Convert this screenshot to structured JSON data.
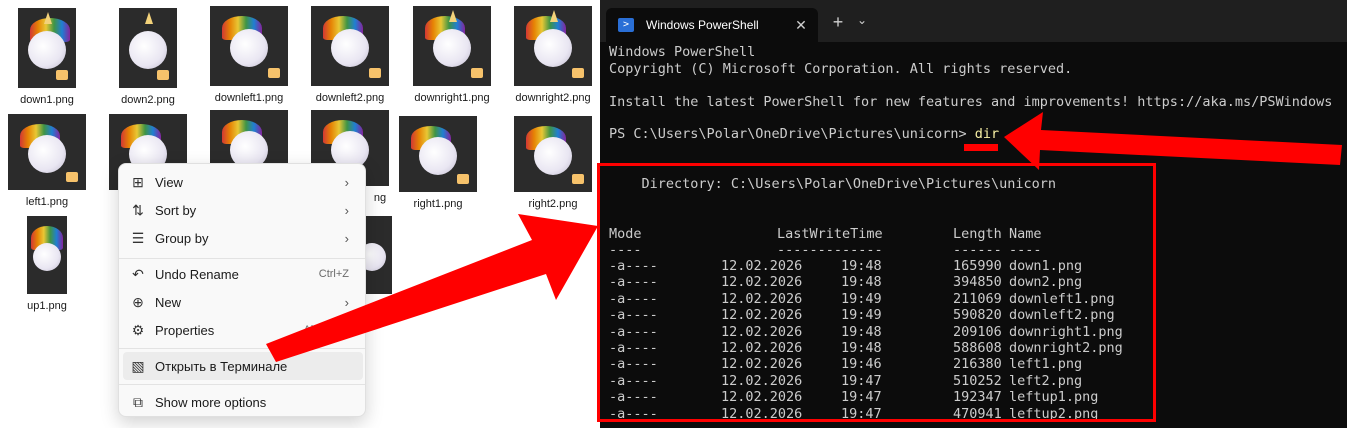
{
  "explorer": {
    "files": [
      {
        "name": "down1.png"
      },
      {
        "name": "down2.png"
      },
      {
        "name": "downleft1.png"
      },
      {
        "name": "downleft2.png"
      },
      {
        "name": "downright1.png"
      },
      {
        "name": "downright2.png"
      },
      {
        "name": "left1.png"
      },
      {
        "name": "right1.png"
      },
      {
        "name": "right2.png"
      },
      {
        "name": "up1.png"
      }
    ],
    "partial_labels": [
      "ng",
      "ng"
    ]
  },
  "context_menu": {
    "items": [
      {
        "label": "View",
        "icon": "grid-icon",
        "has_submenu": true
      },
      {
        "label": "Sort by",
        "icon": "sort-icon",
        "has_submenu": true
      },
      {
        "label": "Group by",
        "icon": "list-icon",
        "has_submenu": true
      },
      {
        "label": "Undo Rename",
        "icon": "undo-icon",
        "shortcut": "Ctrl+Z"
      },
      {
        "label": "New",
        "icon": "plus-circle-icon",
        "has_submenu": true
      },
      {
        "label": "Properties",
        "icon": "wrench-icon",
        "shortcut": "Alt+Enter"
      },
      {
        "label": "Открыть в Терминале",
        "icon": "terminal-icon",
        "highlighted": true
      },
      {
        "label": "Show more options",
        "icon": "share-icon"
      }
    ]
  },
  "terminal": {
    "tab_title": "Windows PowerShell",
    "banner_1": "Windows PowerShell",
    "banner_2": "Copyright (C) Microsoft Corporation. All rights reserved.",
    "banner_3": "Install the latest PowerShell for new features and improvements! https://aka.ms/PSWindows",
    "prompt": "PS C:\\Users\\Polar\\OneDrive\\Pictures\\unicorn> ",
    "command": "dir",
    "directory_line": "    Directory: C:\\Users\\Polar\\OneDrive\\Pictures\\unicorn",
    "headers": {
      "mode": "Mode",
      "lastwritetime": "LastWriteTime",
      "length": "Length",
      "name": "Name"
    },
    "underlines": {
      "mode": "----",
      "lastwritetime": "-------------",
      "length": "------",
      "name": "----"
    },
    "rows": [
      {
        "mode": "-a----",
        "date": "12.02.2026",
        "time": "19:48",
        "length": "165990",
        "name": "down1.png"
      },
      {
        "mode": "-a----",
        "date": "12.02.2026",
        "time": "19:48",
        "length": "394850",
        "name": "down2.png"
      },
      {
        "mode": "-a----",
        "date": "12.02.2026",
        "time": "19:49",
        "length": "211069",
        "name": "downleft1.png"
      },
      {
        "mode": "-a----",
        "date": "12.02.2026",
        "time": "19:49",
        "length": "590820",
        "name": "downleft2.png"
      },
      {
        "mode": "-a----",
        "date": "12.02.2026",
        "time": "19:48",
        "length": "209106",
        "name": "downright1.png"
      },
      {
        "mode": "-a----",
        "date": "12.02.2026",
        "time": "19:48",
        "length": "588608",
        "name": "downright2.png"
      },
      {
        "mode": "-a----",
        "date": "12.02.2026",
        "time": "19:46",
        "length": "216380",
        "name": "left1.png"
      },
      {
        "mode": "-a----",
        "date": "12.02.2026",
        "time": "19:47",
        "length": "510252",
        "name": "left2.png"
      },
      {
        "mode": "-a----",
        "date": "12.02.2026",
        "time": "19:47",
        "length": "192347",
        "name": "leftup1.png"
      },
      {
        "mode": "-a----",
        "date": "12.02.2026",
        "time": "19:47",
        "length": "470941",
        "name": "leftup2.png"
      }
    ]
  },
  "annotation_color": "#ff0000"
}
